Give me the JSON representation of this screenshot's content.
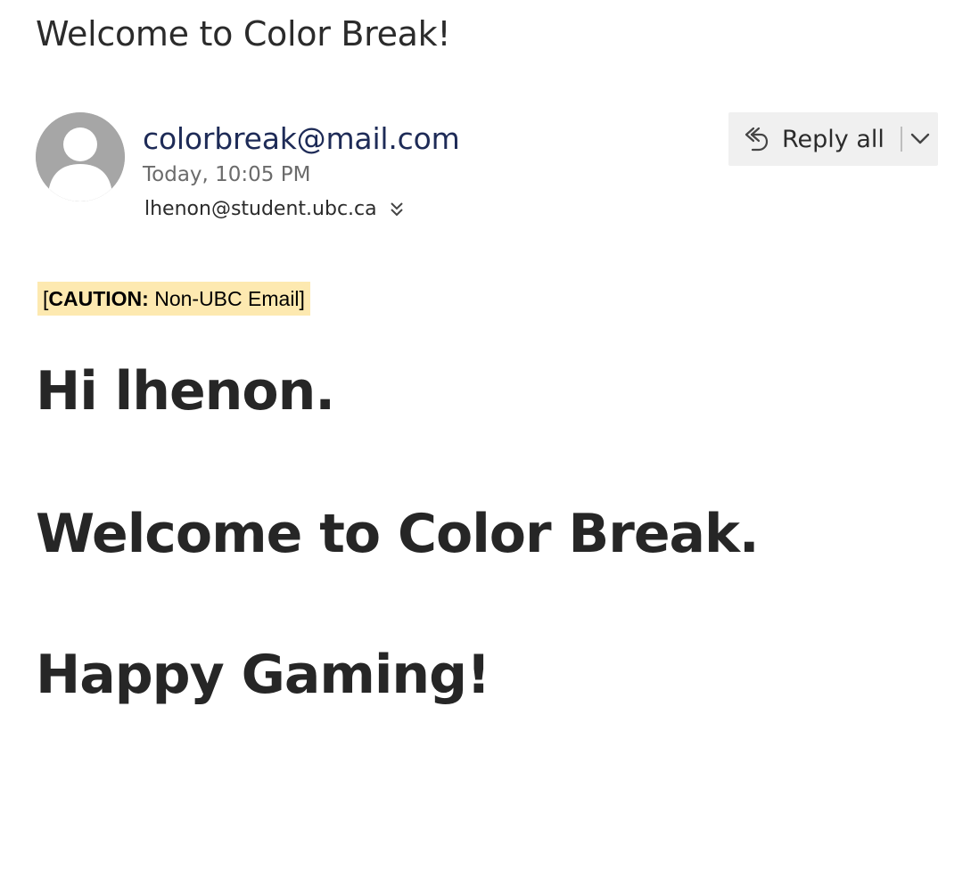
{
  "email": {
    "subject": "Welcome to Color Break!",
    "sender": "colorbreak@mail.com",
    "date": "Today, 10:05 PM",
    "recipient": "lhenon@student.ubc.ca",
    "expand_recipients_icon": "double-chevron-down-icon",
    "avatar_icon": "person-avatar-icon"
  },
  "actions": {
    "reply_all_label": "Reply all",
    "reply_all_icon": "reply-all-icon",
    "more_icon": "chevron-down-icon"
  },
  "caution": {
    "open_bracket": "[",
    "label": "CAUTION:",
    "text": " Non-UBC Email]",
    "background": "#fde9b0"
  },
  "body": {
    "lines": [
      "Hi lhenon.",
      "Welcome to Color Break.",
      "Happy Gaming!"
    ]
  },
  "colors": {
    "sender": "#1e2b57",
    "action_bar": "#f0f0f0",
    "avatar": "#a6a6a6"
  }
}
